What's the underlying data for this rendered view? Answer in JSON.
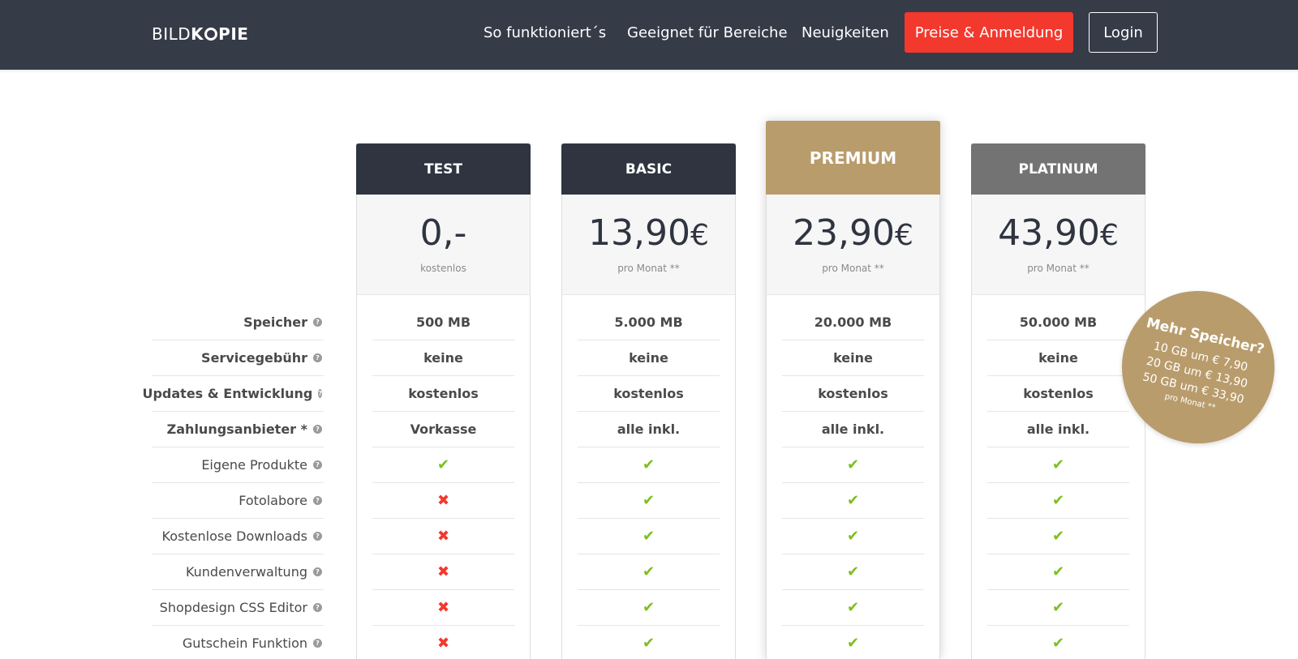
{
  "header": {
    "logo": {
      "part1": "BILD",
      "part2": "K",
      "part3": "PIE"
    },
    "nav": [
      "So funktioniert´s",
      "Geeignet für Bereiche",
      "Neuigkeiten"
    ],
    "primary_button": "Preise & Anmeldung",
    "login_button": "Login",
    "colors": {
      "bar": "#363b48",
      "primary": "#f3382d"
    }
  },
  "features": [
    {
      "label": "Speicher",
      "strong": true
    },
    {
      "label": "Servicegebühr",
      "strong": true
    },
    {
      "label": "Updates & Entwicklung",
      "strong": true
    },
    {
      "label": "Zahlungsanbieter *",
      "strong": true
    },
    {
      "label": "Eigene Produkte",
      "strong": false
    },
    {
      "label": "Fotolabore",
      "strong": false
    },
    {
      "label": "Kostenlose Downloads",
      "strong": false
    },
    {
      "label": "Kundenverwaltung",
      "strong": false
    },
    {
      "label": "Shopdesign CSS Editor",
      "strong": false
    },
    {
      "label": "Gutschein Funktion",
      "strong": false
    }
  ],
  "help_icon": "question-circle-icon",
  "plans": [
    {
      "name": "TEST",
      "price": "0,-",
      "currency": "",
      "note": "kostenlos",
      "color": "#2f3440",
      "values": [
        "500 MB",
        "keine",
        "kostenlos",
        "Vorkasse"
      ],
      "flags": [
        "check",
        "cross",
        "cross",
        "cross",
        "cross",
        "cross"
      ]
    },
    {
      "name": "BASIC",
      "price": "13,90",
      "currency": "€",
      "note": "pro Monat **",
      "color": "#2f3440",
      "values": [
        "5.000 MB",
        "keine",
        "kostenlos",
        "alle inkl."
      ],
      "flags": [
        "check",
        "check",
        "check",
        "check",
        "check",
        "check"
      ]
    },
    {
      "name": "PREMIUM",
      "price": "23,90",
      "currency": "€",
      "note": "pro Monat **",
      "color": "#b99c6c",
      "values": [
        "20.000 MB",
        "keine",
        "kostenlos",
        "alle inkl."
      ],
      "flags": [
        "check",
        "check",
        "check",
        "check",
        "check",
        "check"
      ]
    },
    {
      "name": "PLATINUM",
      "price": "43,90",
      "currency": "€",
      "note": "pro Monat **",
      "color": "#737373",
      "values": [
        "50.000 MB",
        "keine",
        "kostenlos",
        "alle inkl."
      ],
      "flags": [
        "check",
        "check",
        "check",
        "check",
        "check",
        "check"
      ]
    }
  ],
  "bubble": {
    "title": "Mehr Speicher?",
    "lines": [
      "10 GB um € 7,90",
      "20 GB um € 13,90",
      "50 GB um € 33,90"
    ],
    "note": "pro Monat **",
    "color": "#b99c6c"
  }
}
